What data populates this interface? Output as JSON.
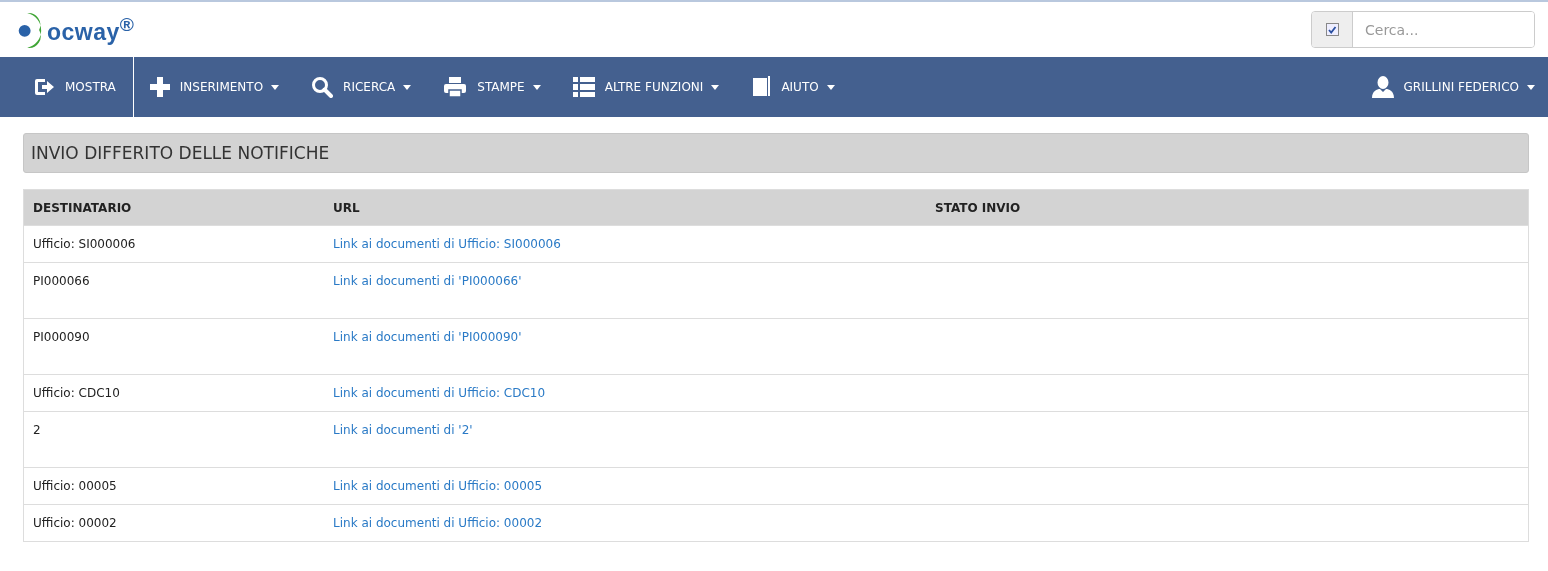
{
  "logo": {
    "text": "ocway$^{®}$"
  },
  "search": {
    "checked": true,
    "placeholder": "Cerca..."
  },
  "nav": {
    "items": [
      {
        "label": "MOSTRA",
        "kind": "exit",
        "dropdown": false
      },
      {
        "label": "INSERIMENTO",
        "kind": "plus",
        "dropdown": true
      },
      {
        "label": "RICERCA",
        "kind": "search",
        "dropdown": true
      },
      {
        "label": "STAMPE",
        "kind": "print",
        "dropdown": true
      },
      {
        "label": "ALTRE FUNZIONI",
        "kind": "list",
        "dropdown": true
      },
      {
        "label": "AIUTO",
        "kind": "book",
        "dropdown": true
      }
    ],
    "user": {
      "label": "GRILLINI FEDERICO",
      "dropdown": true
    }
  },
  "panel": {
    "title": "INVIO DIFFERITO DELLE NOTIFICHE"
  },
  "table": {
    "columns": [
      "DESTINATARIO",
      "URL",
      "STATO INVIO"
    ],
    "rows": [
      {
        "kind": "single",
        "destinatario": "Ufficio: SI000006",
        "url": "Link ai documenti di Ufficio: SI000006"
      },
      {
        "kind": "tall",
        "destinatario": "PI000066",
        "url": "Link ai documenti di 'PI000066'"
      },
      {
        "kind": "tall",
        "destinatario": "PI000090",
        "url": "Link ai documenti di 'PI000090'"
      },
      {
        "kind": "single",
        "destinatario": "Ufficio: CDC10",
        "url": "Link ai documenti di Ufficio: CDC10"
      },
      {
        "kind": "tall",
        "destinatario": "2",
        "url": "Link ai documenti di '2'"
      },
      {
        "kind": "single",
        "destinatario": "Ufficio: 00005",
        "url": "Link ai documenti di Ufficio: 00005"
      },
      {
        "kind": "single",
        "destinatario": "Ufficio: 00002",
        "url": "Link ai documenti di Ufficio: 00002"
      }
    ]
  }
}
